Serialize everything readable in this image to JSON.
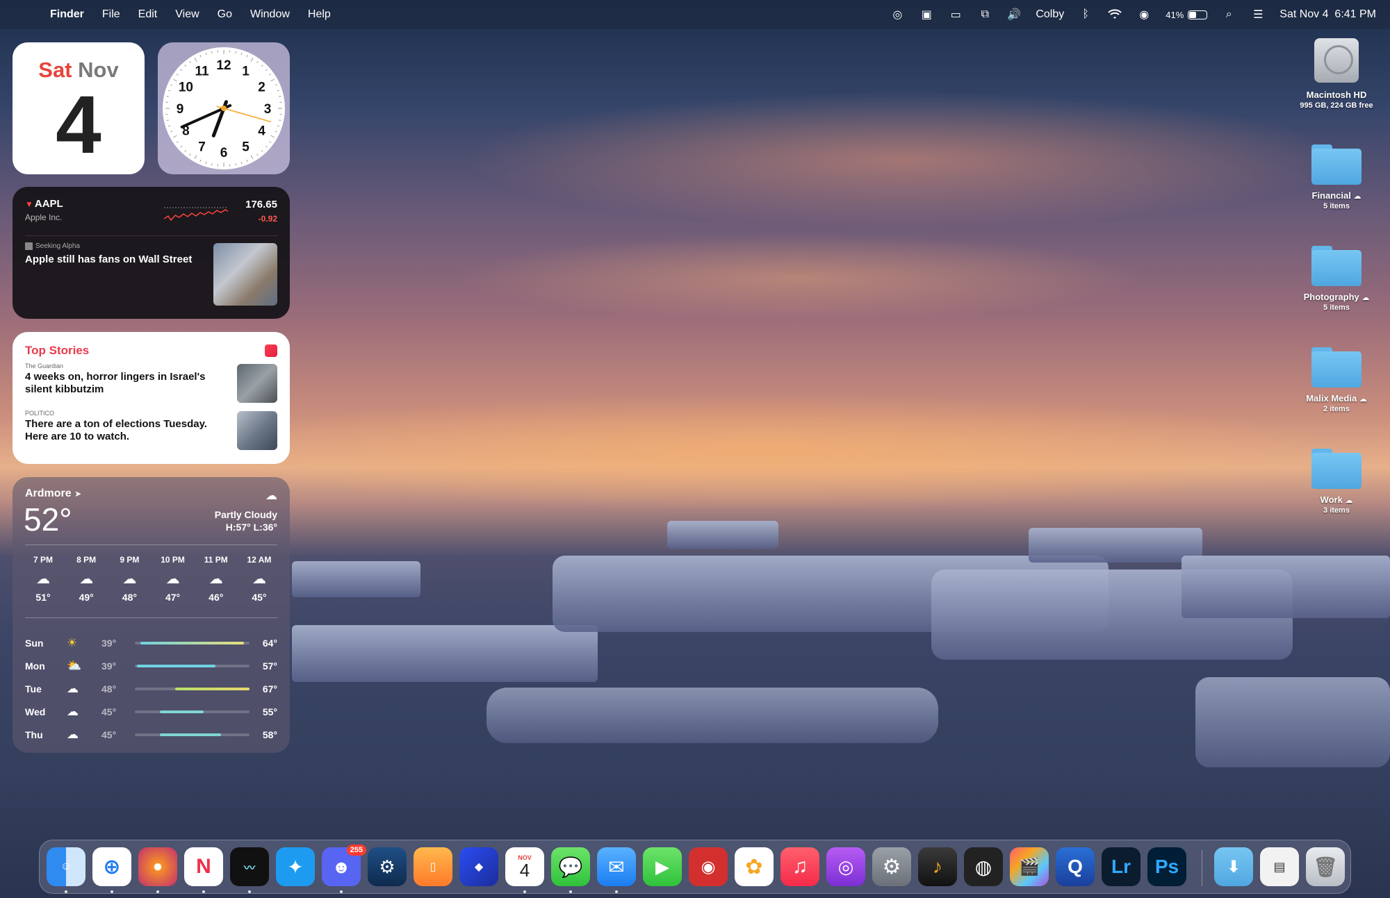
{
  "menubar": {
    "app_name": "Finder",
    "items": [
      "File",
      "Edit",
      "View",
      "Go",
      "Window",
      "Help"
    ],
    "user": "Colby",
    "battery": "41%",
    "battery_level": 0.41,
    "datetime": "Sat Nov 4  6:41 PM"
  },
  "calendar_widget": {
    "dow": "Sat",
    "month": "Nov",
    "day": "4"
  },
  "clock_widget": {
    "numbers": [
      "12",
      "1",
      "2",
      "3",
      "4",
      "5",
      "6",
      "7",
      "8",
      "9",
      "10",
      "11"
    ],
    "time": "6:41"
  },
  "stocks_widget": {
    "symbol": "AAPL",
    "company": "Apple Inc.",
    "price": "176.65",
    "change": "-0.92",
    "source": "Seeking Alpha",
    "headline": "Apple still has fans on Wall Street"
  },
  "news_widget": {
    "title": "Top Stories",
    "items": [
      {
        "source": "The Guardian",
        "headline": "4 weeks on, horror lingers in Israel's silent kibbutzim"
      },
      {
        "source": "POLITICO",
        "headline": "There are a ton of elections Tuesday. Here are 10 to watch."
      }
    ]
  },
  "weather_widget": {
    "location": "Ardmore",
    "temperature": "52°",
    "condition": "Partly Cloudy",
    "hilo": "H:57° L:36°",
    "hourly": [
      {
        "time": "7 PM",
        "temp": "51°"
      },
      {
        "time": "8 PM",
        "temp": "49°"
      },
      {
        "time": "9 PM",
        "temp": "48°"
      },
      {
        "time": "10 PM",
        "temp": "47°"
      },
      {
        "time": "11 PM",
        "temp": "46°"
      },
      {
        "time": "12 AM",
        "temp": "45°"
      }
    ],
    "daily": [
      {
        "day": "Sun",
        "low": "39°",
        "high": "64°",
        "icon": "sun-icon"
      },
      {
        "day": "Mon",
        "low": "39°",
        "high": "57°",
        "icon": "partly-sunny-icon"
      },
      {
        "day": "Tue",
        "low": "48°",
        "high": "67°",
        "icon": "cloud-icon"
      },
      {
        "day": "Wed",
        "low": "45°",
        "high": "55°",
        "icon": "cloud-icon"
      },
      {
        "day": "Thu",
        "low": "45°",
        "high": "58°",
        "icon": "rain-cloud-icon"
      }
    ]
  },
  "desktop_items": [
    {
      "name": "Macintosh HD",
      "sub": "995 GB, 224 GB free",
      "type": "disk"
    },
    {
      "name": "Financial",
      "sub": "5 items",
      "type": "folder"
    },
    {
      "name": "Photography",
      "sub": "5 items",
      "type": "folder"
    },
    {
      "name": "Malix Media",
      "sub": "2 items",
      "type": "folder"
    },
    {
      "name": "Work",
      "sub": "3 items",
      "type": "folder"
    }
  ],
  "dock": {
    "calendar_month": "NOV",
    "calendar_day": "4",
    "discord_badge": "255",
    "lightroom_label": "Lr",
    "photoshop_label": "Ps",
    "apps": [
      "Finder",
      "Safari",
      "Firefox",
      "News",
      "Stocks",
      "Twitter",
      "Discord",
      "Steam",
      "Books",
      "3D App",
      "Calendar",
      "Messages",
      "Mail",
      "FaceTime",
      "Photo Booth",
      "Photos",
      "Music",
      "Podcasts",
      "System Settings",
      "GarageBand",
      "Logic Pro",
      "Final Cut Pro",
      "QuickTime",
      "Lightroom",
      "Photoshop",
      "Downloads",
      "Recent Document",
      "Trash"
    ]
  },
  "colors": {
    "calendar_red": "#e7433c",
    "stock_down": "#ff5a4f",
    "news_red": "#ea3a4b",
    "folder_blue": "#5fb4ea"
  }
}
